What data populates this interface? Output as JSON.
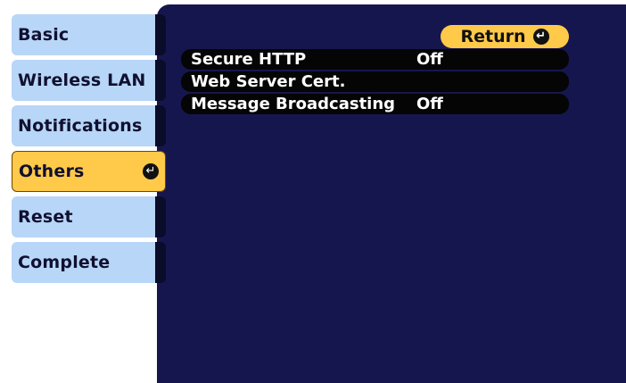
{
  "sidebar": {
    "items": [
      {
        "label": "Basic"
      },
      {
        "label": "Wireless LAN"
      },
      {
        "label": "Notifications"
      },
      {
        "label": "Others"
      },
      {
        "label": "Reset"
      },
      {
        "label": "Complete"
      }
    ]
  },
  "main": {
    "return_label": "Return",
    "settings": [
      {
        "label": "Secure HTTP",
        "value": "Off"
      },
      {
        "label": "Web Server Cert.",
        "value": ""
      },
      {
        "label": "Message Broadcasting",
        "value": "Off"
      }
    ]
  },
  "colors": {
    "panel_bg": "#16164f",
    "tab_bg": "#b8d6f7",
    "selected_bg": "#ffc94a",
    "row_bg": "#050505"
  },
  "icons": {
    "enter": "enter-icon"
  }
}
